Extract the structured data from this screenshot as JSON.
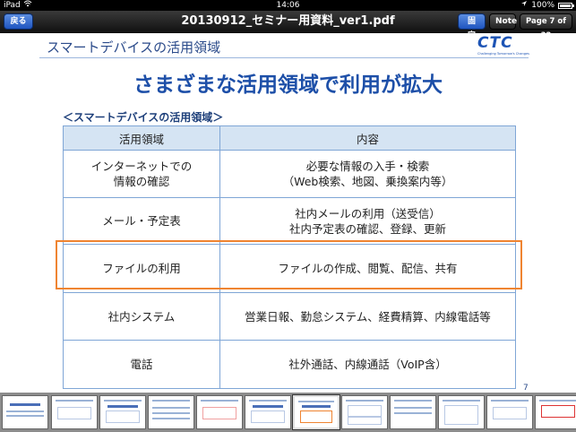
{
  "status": {
    "carrier": "iPad",
    "time": "14:06",
    "battery": "100%"
  },
  "nav": {
    "back_label": "戻る",
    "title": "20130912_セミナー用資料_ver1.pdf",
    "fix_label": "固定",
    "note_label": "Note",
    "page_label": "Page 7 of 32"
  },
  "slide": {
    "header": "スマートデバイスの活用領域",
    "logo": {
      "text": "CTC",
      "tagline": "Challenging Tomorrow's Changes"
    },
    "title": "さまざまな活用領域で利用が拡大",
    "section_label": "＜スマートデバイスの活用領域＞",
    "table": {
      "headers": [
        "活用領域",
        "内容"
      ],
      "rows": [
        {
          "area": "インターネットでの",
          "area2": "情報の確認",
          "content": "必要な情報の入手・検索",
          "content2": "（Web検索、地図、乗換案内等）"
        },
        {
          "area": "メール・予定表",
          "area2": "",
          "content": "社内メールの利用（送受信）",
          "content2": "社内予定表の確認、登録、更新"
        },
        {
          "area": "ファイルの利用",
          "area2": "",
          "content": "ファイルの作成、閲覧、配信、共有",
          "content2": ""
        },
        {
          "area": "社内システム",
          "area2": "",
          "content": "営業日報、勤怠システム、経費精算、内線電話等",
          "content2": ""
        },
        {
          "area": "電話",
          "area2": "",
          "content": "社外通話、内線通話（VoIP含）",
          "content2": ""
        }
      ]
    },
    "page_number": "7"
  },
  "colors": {
    "nav_blue": "#1f55c0",
    "title_blue": "#1d4fa8",
    "highlight_orange": "#ef8431",
    "header_fill": "#d5e4f3"
  },
  "icons": [
    "wifi-icon",
    "location-arrow-icon",
    "battery-icon"
  ]
}
